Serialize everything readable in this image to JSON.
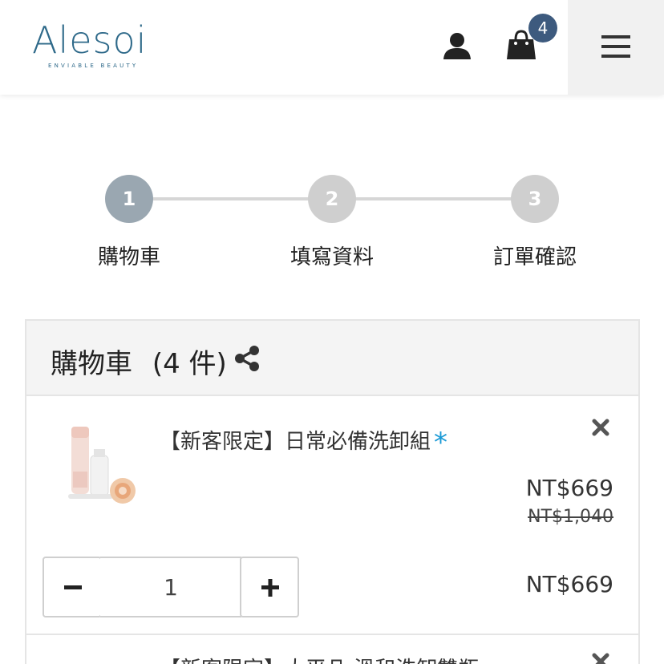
{
  "header": {
    "logo_text": "Alesoi",
    "logo_tagline": "ENVIABLE BEAUTY",
    "user_icon": "user-icon",
    "cart_icon": "shopping-bag-icon",
    "cart_count": "4",
    "menu_icon": "hamburger-menu-icon"
  },
  "steps": [
    {
      "number": "1",
      "label": "購物車",
      "active": true
    },
    {
      "number": "2",
      "label": "填寫資料",
      "active": false
    },
    {
      "number": "3",
      "label": "訂單確認",
      "active": false
    }
  ],
  "cart": {
    "title": "購物車",
    "count_text": "(4 件)",
    "share_icon": "share-icon",
    "items": [
      {
        "name": "【新客限定】日常必備洗卸組",
        "required_mark": "*",
        "price_sale": "NT$669",
        "price_original": "NT$1,040",
        "quantity": "1",
        "line_total": "NT$669"
      },
      {
        "name": "【新客限定】大平凡 溫和洗卸雙瓶..."
      }
    ]
  },
  "colors": {
    "step_active": "#9aa7b1",
    "step_inactive": "#cfcfcf",
    "badge": "#3d5a7e",
    "star": "#1a9ad6",
    "logo": "#2f6a8a"
  }
}
